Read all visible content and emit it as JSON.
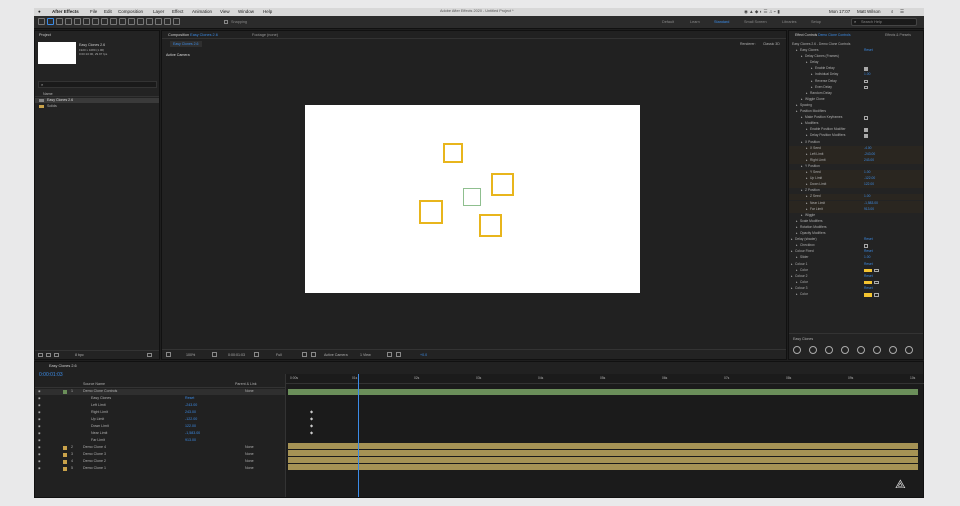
{
  "menubar": {
    "app": "After Effects",
    "items": [
      "File",
      "Edit",
      "Composition",
      "Layer",
      "Effect",
      "Animation",
      "View",
      "Window",
      "Help"
    ],
    "center_title": "Adobe After Effects 2020 - Untitled Project *",
    "clock": "Mon 17:07",
    "user": "Matt Wilson"
  },
  "toolbar": {
    "snapping": "Snapping",
    "workspaces": [
      "Default",
      "Learn",
      "Standard",
      "Small Screen",
      "Libraries",
      "Setup"
    ],
    "active_workspace": "Standard",
    "search_placeholder": "Search Help"
  },
  "project": {
    "tab": "Project",
    "item_name": "Easy Clones 2.6",
    "item_meta": [
      "1920 x 1080 (1.00)",
      "0:00:10:00, 29.97 fps"
    ],
    "search_placeholder": "",
    "header": "Name",
    "items": [
      "Easy Clones 2.6",
      "Solids"
    ],
    "bpc": "8 bpc"
  },
  "composition": {
    "tab": "Composition",
    "comp_link": "Easy Clones 2.6",
    "footage_tab": "Footage (none)",
    "subtab": "Easy Clones 2.6",
    "renderer_label": "Renderer:",
    "renderer": "Classic 3D",
    "camera_label": "Active Camera",
    "zoom": "100%",
    "timecode": "0:00:01:03",
    "resolution": "Full",
    "camera_dropdown": "Active Camera",
    "view_dropdown": "1 View",
    "exposure": "+0.0"
  },
  "effects": {
    "tab": "Effect Controls",
    "tab_target": "Demo Clone Controls",
    "tab2": "Effects & Presets",
    "crumb": "Easy Clones 2.6 - Demo Clone Controls",
    "rows": [
      {
        "label": "Easy Clones",
        "value": "Reset",
        "ind": 1
      },
      {
        "label": "Delay Clones (Frames)",
        "value": "",
        "ind": 2
      },
      {
        "label": "Delay",
        "value": "",
        "ind": 3
      },
      {
        "label": "Enable Delay",
        "value": "check",
        "ind": 4
      },
      {
        "label": "Individual Delay",
        "value": "1.00",
        "ind": 4
      },
      {
        "label": "Reverse Delay",
        "value": "box",
        "ind": 4
      },
      {
        "label": "Even Delay",
        "value": "box",
        "ind": 4
      },
      {
        "label": "Random Delay",
        "value": "",
        "ind": 3
      },
      {
        "label": "Wiggle Clone",
        "value": "",
        "ind": 2
      },
      {
        "label": "Spacing",
        "value": "",
        "ind": 1
      },
      {
        "label": "Position Modifiers",
        "value": "",
        "ind": 1
      },
      {
        "label": "Make Position Keyframes",
        "value": "box",
        "ind": 2
      },
      {
        "label": "Modifiers",
        "value": "",
        "ind": 2
      },
      {
        "label": "Enable Position Modifier",
        "value": "check",
        "ind": 3
      },
      {
        "label": "Delay Position Modifiers",
        "value": "check",
        "ind": 3
      },
      {
        "label": "X Position",
        "value": "",
        "ind": 2
      },
      {
        "label": "X Seed",
        "value": "-4.00",
        "ind": 3
      },
      {
        "label": "Left Limit",
        "value": "-243.00",
        "ind": 3
      },
      {
        "label": "Right Limit",
        "value": "243.00",
        "ind": 3
      },
      {
        "label": "Y Position",
        "value": "",
        "ind": 2
      },
      {
        "label": "Y Seed",
        "value": "1.00",
        "ind": 3
      },
      {
        "label": "Up Limit",
        "value": "-122.00",
        "ind": 3
      },
      {
        "label": "Down Limit",
        "value": "122.00",
        "ind": 3
      },
      {
        "label": "Z Position",
        "value": "",
        "ind": 2
      },
      {
        "label": "Z Seed",
        "value": "1.00",
        "ind": 3
      },
      {
        "label": "Near Limit",
        "value": "-1,583.00",
        "ind": 3
      },
      {
        "label": "Far Limit",
        "value": "913.00",
        "ind": 3
      },
      {
        "label": "Wiggle",
        "value": "",
        "ind": 2
      },
      {
        "label": "Scale Modifiers",
        "value": "",
        "ind": 1
      },
      {
        "label": "Rotation Modifiers",
        "value": "",
        "ind": 1
      },
      {
        "label": "Opacity Modifiers",
        "value": "",
        "ind": 1
      },
      {
        "label": "Delay (shader)",
        "value": "Reset",
        "ind": 0
      },
      {
        "label": "Checkbox",
        "value": "box",
        "ind": 1
      },
      {
        "label": "Colour Fixed",
        "value": "Reset",
        "ind": 0
      },
      {
        "label": "Slider",
        "value": "1.00",
        "ind": 1
      },
      {
        "label": "Colour 1",
        "value": "Reset",
        "ind": 0
      },
      {
        "label": "Color",
        "value": "swatch",
        "ind": 1
      },
      {
        "label": "Colour 2",
        "value": "Reset",
        "ind": 0
      },
      {
        "label": "Color",
        "value": "swatch",
        "ind": 1
      },
      {
        "label": "Colour 3",
        "value": "Reset",
        "ind": 0
      },
      {
        "label": "Color",
        "value": "swatch",
        "ind": 1
      }
    ],
    "footer_title": "Easy Clones",
    "swatch_color": "#f4c430"
  },
  "timeline": {
    "tab": "Easy Clones 2.6",
    "timecode": "0:00:01:03",
    "columns": [
      "Source Name",
      "Parent & Link"
    ],
    "layers": [
      {
        "num": "1",
        "name": "Demo Clone Controls",
        "parent": "None"
      },
      {
        "num": "",
        "name": "Easy Clones",
        "parent": "Reset"
      },
      {
        "num": "",
        "name": "Left Limit",
        "parent": "-243.00"
      },
      {
        "num": "",
        "name": "Right Limit",
        "parent": "243.00"
      },
      {
        "num": "",
        "name": "Up Limit",
        "parent": "-122.00"
      },
      {
        "num": "",
        "name": "Down Limit",
        "parent": "122.00"
      },
      {
        "num": "",
        "name": "Near Limit",
        "parent": "-1,583.00"
      },
      {
        "num": "",
        "name": "Far Limit",
        "parent": "913.00"
      },
      {
        "num": "2",
        "name": "Demo Clone 4",
        "parent": "None"
      },
      {
        "num": "3",
        "name": "Demo Clone 3",
        "parent": "None"
      },
      {
        "num": "4",
        "name": "Demo Clone 2",
        "parent": "None"
      },
      {
        "num": "5",
        "name": "Demo Clone 1",
        "parent": "None"
      }
    ],
    "ruler": [
      "0:00s",
      "01s",
      "02s",
      "03s",
      "04s",
      "05s",
      "06s",
      "07s",
      "08s",
      "09s",
      "10s"
    ],
    "playhead_fraction": 0.113
  },
  "colors": {
    "accent": "#3c8ce7",
    "clone_square": "#e8b51c",
    "clone_selected": "#8fbf8f",
    "layer_bar": "#a69355",
    "control_bar": "#6b8f5a"
  }
}
